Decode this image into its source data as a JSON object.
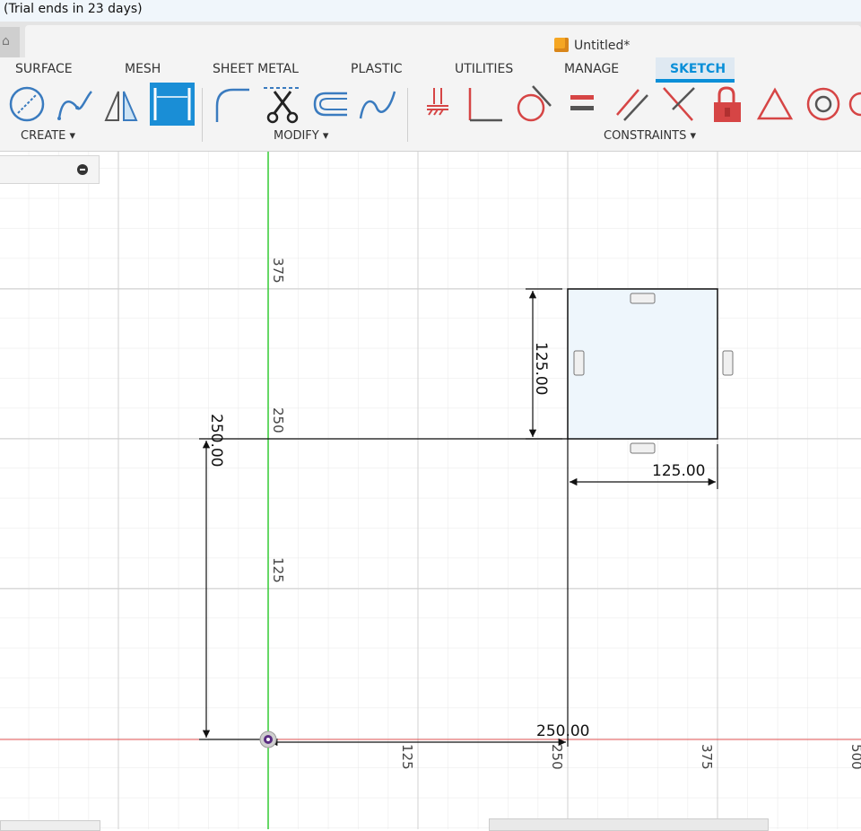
{
  "window": {
    "trial_text": "(Trial ends in 23 days)",
    "document_title": "Untitled*"
  },
  "ribbon": {
    "tabs": [
      {
        "label": "SURFACE"
      },
      {
        "label": "MESH"
      },
      {
        "label": "SHEET METAL"
      },
      {
        "label": "PLASTIC"
      },
      {
        "label": "UTILITIES"
      },
      {
        "label": "MANAGE"
      },
      {
        "label": "SKETCH",
        "active": true
      }
    ],
    "groups": {
      "create": "CREATE ▾",
      "modify": "MODIFY ▾",
      "constraints": "CONSTRAINTS ▾"
    },
    "accent": "#0a8fd8"
  },
  "canvas": {
    "ruler_labels_vertical": [
      "375",
      "250",
      "125"
    ],
    "ruler_labels_horizontal": [
      "125",
      "250",
      "375",
      "500"
    ],
    "dimensions": {
      "rect_height": "125.00",
      "rect_width": "125.00",
      "offset_vertical": "250.00",
      "offset_horizontal": "250.00"
    },
    "colors": {
      "y_axis": "#33cc33",
      "x_axis": "#e05050",
      "sketch_fill": "#eef6fc",
      "grid": "#e6e6e6"
    }
  }
}
